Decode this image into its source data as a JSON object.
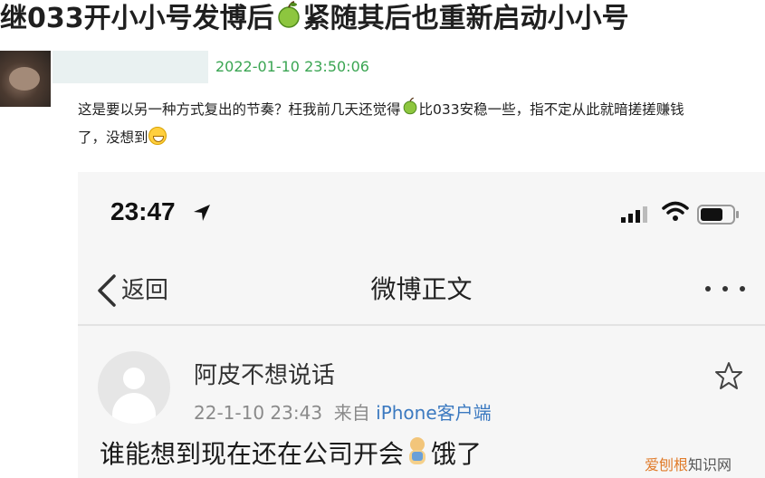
{
  "headline": {
    "part1": "继033开小小号发博后",
    "part2": "紧随其后也重新启动小小号"
  },
  "comment": {
    "timestamp": "2022-01-10 23:50:06",
    "line1_a": "这是要以另一种方式复出的节奏？枉我前几天还觉得",
    "line1_b": "比033安稳一些，指不定从此就暗搓搓赚钱",
    "line2": "了，没想到"
  },
  "phone": {
    "status_time": "23:47",
    "nav": {
      "back_label": "返回",
      "title": "微博正文"
    },
    "post": {
      "username": "阿皮不想说话",
      "time": "22-1-10 23:43",
      "source_prefix": "来自",
      "source": "iPhone客户端",
      "text_a": "谁能想到现在还在公司开会",
      "text_b": "饿了"
    }
  },
  "watermark": {
    "part1": "爱刨根",
    "part2": "知识网"
  },
  "colors": {
    "timestamp_green": "#3aa552",
    "link_blue": "#3b79c0",
    "pear_green": "#8dc63f"
  },
  "icons": [
    "pear-icon",
    "grin-emoji-icon",
    "location-arrow-icon",
    "signal-icon",
    "wifi-icon",
    "battery-icon",
    "back-chevron-icon",
    "more-icon",
    "star-icon",
    "baby-emoji-icon"
  ]
}
